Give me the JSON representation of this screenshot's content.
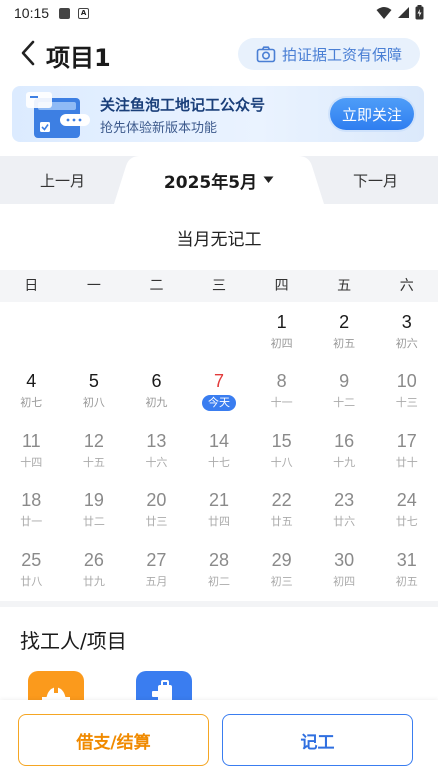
{
  "status_bar": {
    "time": "10:15"
  },
  "header": {
    "title": "项目1",
    "photo_button": "拍证据工资有保障"
  },
  "banner": {
    "title": "关注鱼泡工地记工公众号",
    "subtitle": "抢先体验新版本功能",
    "button": "立即关注"
  },
  "month_nav": {
    "prev": "上一月",
    "current": "2025年5月",
    "next": "下一月"
  },
  "empty_text": "当月无记工",
  "weekdays": [
    "日",
    "一",
    "二",
    "三",
    "四",
    "五",
    "六"
  ],
  "calendar": {
    "weeks": [
      [
        null,
        null,
        null,
        null,
        {
          "day": "1",
          "lunar": "初四",
          "state": "past"
        },
        {
          "day": "2",
          "lunar": "初五",
          "state": "past"
        },
        {
          "day": "3",
          "lunar": "初六",
          "state": "past"
        }
      ],
      [
        {
          "day": "4",
          "lunar": "初七",
          "state": "past"
        },
        {
          "day": "5",
          "lunar": "初八",
          "state": "past"
        },
        {
          "day": "6",
          "lunar": "初九",
          "state": "past"
        },
        {
          "day": "7",
          "lunar": "今天",
          "state": "today"
        },
        {
          "day": "8",
          "lunar": "十一",
          "state": "future"
        },
        {
          "day": "9",
          "lunar": "十二",
          "state": "future"
        },
        {
          "day": "10",
          "lunar": "十三",
          "state": "future"
        }
      ],
      [
        {
          "day": "11",
          "lunar": "十四",
          "state": "future"
        },
        {
          "day": "12",
          "lunar": "十五",
          "state": "future"
        },
        {
          "day": "13",
          "lunar": "十六",
          "state": "future"
        },
        {
          "day": "14",
          "lunar": "十七",
          "state": "future"
        },
        {
          "day": "15",
          "lunar": "十八",
          "state": "future"
        },
        {
          "day": "16",
          "lunar": "十九",
          "state": "future"
        },
        {
          "day": "17",
          "lunar": "廿十",
          "state": "future"
        }
      ],
      [
        {
          "day": "18",
          "lunar": "廿一",
          "state": "future"
        },
        {
          "day": "19",
          "lunar": "廿二",
          "state": "future"
        },
        {
          "day": "20",
          "lunar": "廿三",
          "state": "future"
        },
        {
          "day": "21",
          "lunar": "廿四",
          "state": "future"
        },
        {
          "day": "22",
          "lunar": "廿五",
          "state": "future"
        },
        {
          "day": "23",
          "lunar": "廿六",
          "state": "future"
        },
        {
          "day": "24",
          "lunar": "廿七",
          "state": "future"
        }
      ],
      [
        {
          "day": "25",
          "lunar": "廿八",
          "state": "future"
        },
        {
          "day": "26",
          "lunar": "廿九",
          "state": "future"
        },
        {
          "day": "27",
          "lunar": "五月",
          "state": "future"
        },
        {
          "day": "28",
          "lunar": "初二",
          "state": "future"
        },
        {
          "day": "29",
          "lunar": "初三",
          "state": "future"
        },
        {
          "day": "30",
          "lunar": "初四",
          "state": "future"
        },
        {
          "day": "31",
          "lunar": "初五",
          "state": "future"
        }
      ]
    ]
  },
  "section": {
    "title": "找工人/项目"
  },
  "bottom": {
    "loan_button": "借支/结算",
    "record_button": "记工"
  },
  "colors": {
    "accent": "#3a7df0",
    "orange": "#f5a623",
    "today": "#e23b3b"
  }
}
